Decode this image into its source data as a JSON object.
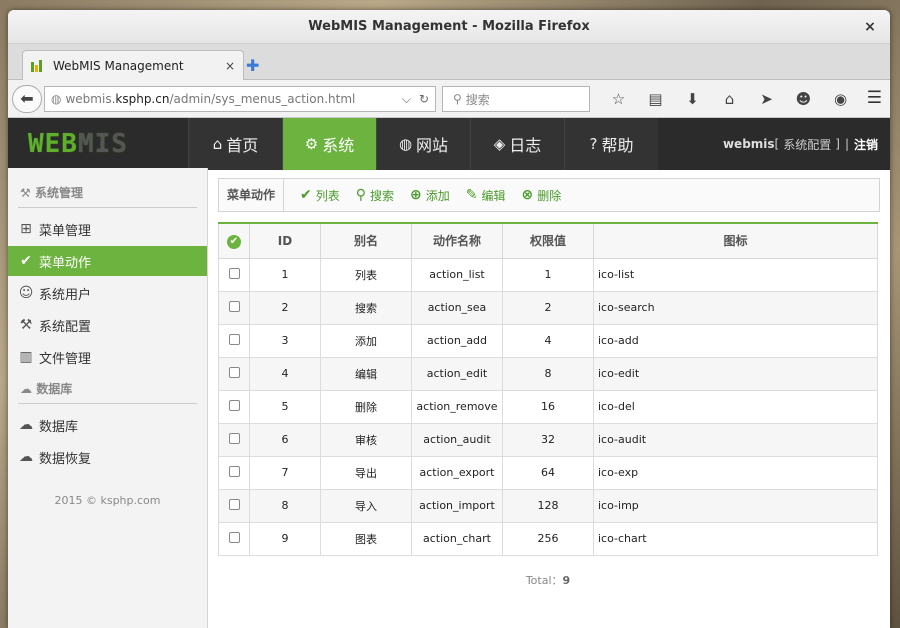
{
  "window": {
    "title": "WebMIS Management - Mozilla Firefox",
    "close_glyph": "×"
  },
  "tab": {
    "label": "WebMIS Management",
    "close_glyph": "×",
    "new_tab_glyph": "✚"
  },
  "urlbar": {
    "prefix": "webmis.",
    "host": "ksphp.cn",
    "path": "/admin/sys_menus_action.html"
  },
  "search": {
    "placeholder": "搜索"
  },
  "browser_icons": [
    "bookmark-star-icon",
    "reading-list-icon",
    "download-icon",
    "home-icon",
    "send-icon",
    "chat-icon",
    "addon-icon"
  ],
  "app": {
    "logo": {
      "bright": "WEB",
      "dim": "MIS"
    },
    "nav": [
      {
        "label": "首页",
        "icon": "home-icon",
        "glyph": "⌂",
        "active": false
      },
      {
        "label": "系统",
        "icon": "gear-icon",
        "glyph": "⚙",
        "active": true
      },
      {
        "label": "网站",
        "icon": "globe-icon",
        "glyph": "◍",
        "active": false
      },
      {
        "label": "日志",
        "icon": "tags-icon",
        "glyph": "◈",
        "active": false
      },
      {
        "label": "帮助",
        "icon": "help-icon",
        "glyph": "?",
        "active": false
      }
    ],
    "user": {
      "name": "webmis",
      "bracket_left": "[",
      "config_link": "系统配置",
      "bracket_right": "]",
      "separator": "|",
      "logout": "注销"
    }
  },
  "sidebar": {
    "group1": {
      "label": "系统管理",
      "icon": "tools-icon",
      "glyph": "⚒"
    },
    "items1": [
      {
        "label": "菜单管理",
        "icon": "sitemap-icon",
        "glyph": "⊞",
        "active": false
      },
      {
        "label": "菜单动作",
        "icon": "check-circle-icon",
        "glyph": "✔",
        "active": true
      },
      {
        "label": "系统用户",
        "icon": "users-icon",
        "glyph": "☺",
        "active": false
      },
      {
        "label": "系统配置",
        "icon": "wrench-icon",
        "glyph": "⚒",
        "active": false
      },
      {
        "label": "文件管理",
        "icon": "library-icon",
        "glyph": "▥",
        "active": false
      }
    ],
    "group2": {
      "label": "数据库",
      "icon": "cloud-icon",
      "glyph": "☁"
    },
    "items2": [
      {
        "label": "数据库",
        "icon": "cloud-download-icon",
        "glyph": "☁",
        "active": false
      },
      {
        "label": "数据恢复",
        "icon": "cloud-upload-icon",
        "glyph": "☁",
        "active": false
      }
    ],
    "copyright": "2015 © ksphp.com"
  },
  "toolbar": {
    "title": "菜单动作",
    "buttons": [
      {
        "label": "列表",
        "icon": "list-check-icon",
        "glyph": "✔"
      },
      {
        "label": "搜索",
        "icon": "search-icon",
        "glyph": "⚲"
      },
      {
        "label": "添加",
        "icon": "add-icon",
        "glyph": "⊕"
      },
      {
        "label": "编辑",
        "icon": "edit-icon",
        "glyph": "✎"
      },
      {
        "label": "删除",
        "icon": "delete-icon",
        "glyph": "⊗"
      }
    ]
  },
  "table": {
    "columns": [
      "ID",
      "别名",
      "动作名称",
      "权限值",
      "图标"
    ],
    "rows": [
      {
        "id": "1",
        "alias": "列表",
        "action": "action_list",
        "perm": "1",
        "icon": "ico-list"
      },
      {
        "id": "2",
        "alias": "搜索",
        "action": "action_sea",
        "perm": "2",
        "icon": "ico-search"
      },
      {
        "id": "3",
        "alias": "添加",
        "action": "action_add",
        "perm": "4",
        "icon": "ico-add"
      },
      {
        "id": "4",
        "alias": "编辑",
        "action": "action_edit",
        "perm": "8",
        "icon": "ico-edit"
      },
      {
        "id": "5",
        "alias": "删除",
        "action": "action_remove",
        "perm": "16",
        "icon": "ico-del"
      },
      {
        "id": "6",
        "alias": "审核",
        "action": "action_audit",
        "perm": "32",
        "icon": "ico-audit"
      },
      {
        "id": "7",
        "alias": "导出",
        "action": "action_export",
        "perm": "64",
        "icon": "ico-exp"
      },
      {
        "id": "8",
        "alias": "导入",
        "action": "action_import",
        "perm": "128",
        "icon": "ico-imp"
      },
      {
        "id": "9",
        "alias": "图表",
        "action": "action_chart",
        "perm": "256",
        "icon": "ico-chart"
      }
    ]
  },
  "total": {
    "label": "Total：",
    "value": "9"
  }
}
